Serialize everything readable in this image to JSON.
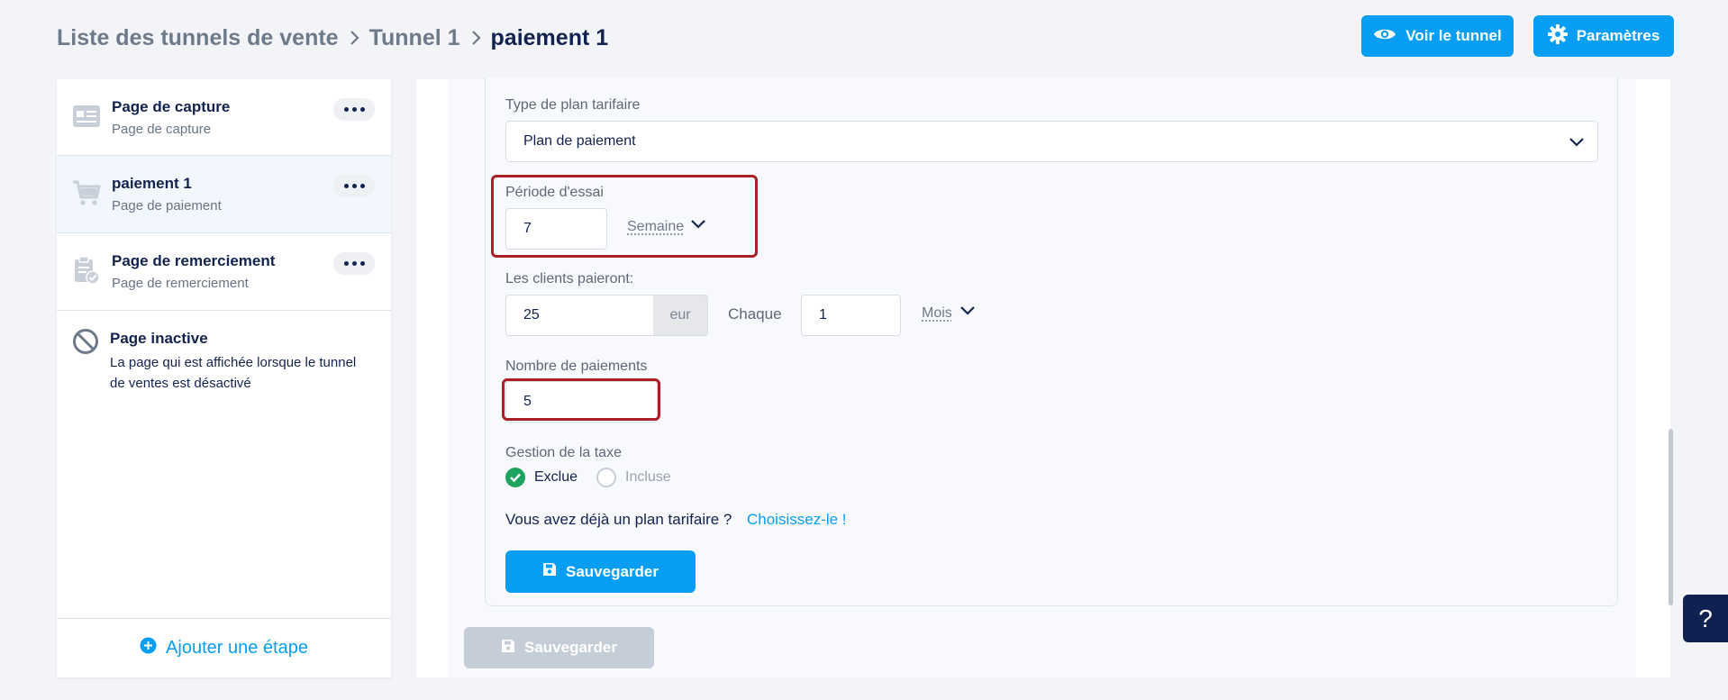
{
  "breadcrumb": {
    "items": [
      "Liste des tunnels de vente",
      "Tunnel 1",
      "paiement 1"
    ]
  },
  "header": {
    "view_button": "Voir le tunnel",
    "settings_button": "Paramètres"
  },
  "sidebar": {
    "steps": [
      {
        "title": "Page de capture",
        "subtitle": "Page de capture",
        "icon": "page-capture-icon"
      },
      {
        "title": "paiement 1",
        "subtitle": "Page de paiement",
        "icon": "cart-icon",
        "active": true
      },
      {
        "title": "Page de remerciement",
        "subtitle": "Page de remerciement",
        "icon": "clipboard-check-icon"
      }
    ],
    "inactive": {
      "title": "Page inactive",
      "description": "La page qui est affichée lorsque le tunnel de ventes est désactivé"
    },
    "add_step": "Ajouter une étape"
  },
  "form": {
    "plan_type_label": "Type de plan tarifaire",
    "plan_type_value": "Plan de paiement",
    "trial_label": "Période d'essai",
    "trial_value": "7",
    "trial_unit": "Semaine",
    "customers_pay_label": "Les clients paieront:",
    "amount_value": "25",
    "currency": "eur",
    "every_label": "Chaque",
    "interval_value": "1",
    "interval_unit": "Mois",
    "payments_label": "Nombre de paiements",
    "payments_value": "5",
    "tax_label": "Gestion de la taxe",
    "tax_excluded": "Exclue",
    "tax_included": "Incluse",
    "existing_plan_text": "Vous avez déjà un plan tarifaire ?",
    "existing_plan_link": "Choisissez-le !",
    "save_label": "Sauvegarder"
  },
  "footer": {
    "save_label": "Sauvegarder"
  },
  "help": {
    "label": "?"
  },
  "colors": {
    "accent": "#079ef4",
    "highlight": "#a91f24",
    "success": "#1ea35e",
    "navy": "#0f2150"
  }
}
